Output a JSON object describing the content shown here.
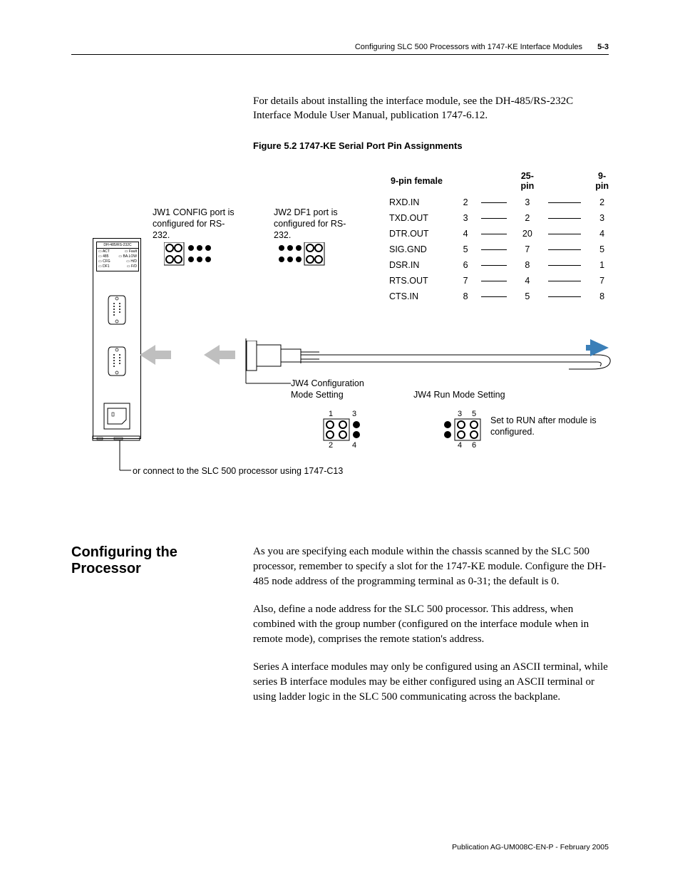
{
  "header": {
    "title": "Configuring SLC 500 Processors with 1747-KE Interface Modules",
    "page": "5-3"
  },
  "intro": "For details about installing the interface module, see the DH-485/RS-232C Interface Module User Manual, publication 1747-6.12.",
  "figure": {
    "caption": "Figure 5.2  1747-KE Serial Port Pin Assignments",
    "labels": {
      "jw1": "JW1 CONFIG port is configured for RS-232.",
      "jw2": "JW2 DF1 port is configured for RS-232.",
      "jw4cfg": "JW4 Configuration Mode Setting",
      "jw4run": "JW4 Run Mode Setting",
      "runnote": "Set to RUN after module is configured.",
      "bottom": "or connect to the SLC 500 processor using 1747-C13",
      "panel_title": "DH-485/RS-232C",
      "panel_rows": [
        "ACT",
        "485",
        "CFG",
        "DF1"
      ],
      "panel_right": [
        "Fault",
        "BA.LOW",
        "H/D",
        "F/D"
      ]
    },
    "pin_headers": [
      "9-pin female",
      "25-pin",
      "9-pin"
    ],
    "pins": [
      {
        "name": "RXD.IN",
        "a": "2",
        "b": "3",
        "c": "2"
      },
      {
        "name": "TXD.OUT",
        "a": "3",
        "b": "2",
        "c": "3"
      },
      {
        "name": "DTR.OUT",
        "a": "4",
        "b": "20",
        "c": "4"
      },
      {
        "name": "SIG.GND",
        "a": "5",
        "b": "7",
        "c": "5"
      },
      {
        "name": "DSR.IN",
        "a": "6",
        "b": "8",
        "c": "1"
      },
      {
        "name": "RTS.OUT",
        "a": "7",
        "b": "4",
        "c": "7"
      },
      {
        "name": "CTS.IN",
        "a": "8",
        "b": "5",
        "c": "8"
      }
    ],
    "jumper_nums": {
      "cfg": [
        "1",
        "3",
        "2",
        "4"
      ],
      "run": [
        "3",
        "5",
        "4",
        "6"
      ]
    }
  },
  "section": {
    "title": "Configuring the Processor",
    "p1": "As you are specifying each module within the chassis scanned by the SLC 500 processor, remember to specify a slot for the 1747-KE module. Configure the DH-485 node address of the programming terminal as 0-31; the default is 0.",
    "p2": "Also, define a node address for the SLC 500 processor. This address, when combined with the group number (configured on the interface module when in remote mode), comprises the remote station's address.",
    "p3": "Series A interface modules may only be configured using an ASCII terminal, while series B interface modules may be either configured using an ASCII terminal or using ladder logic in the SLC 500 communicating across the backplane."
  },
  "footer": "Publication AG-UM008C-EN-P - February 2005"
}
